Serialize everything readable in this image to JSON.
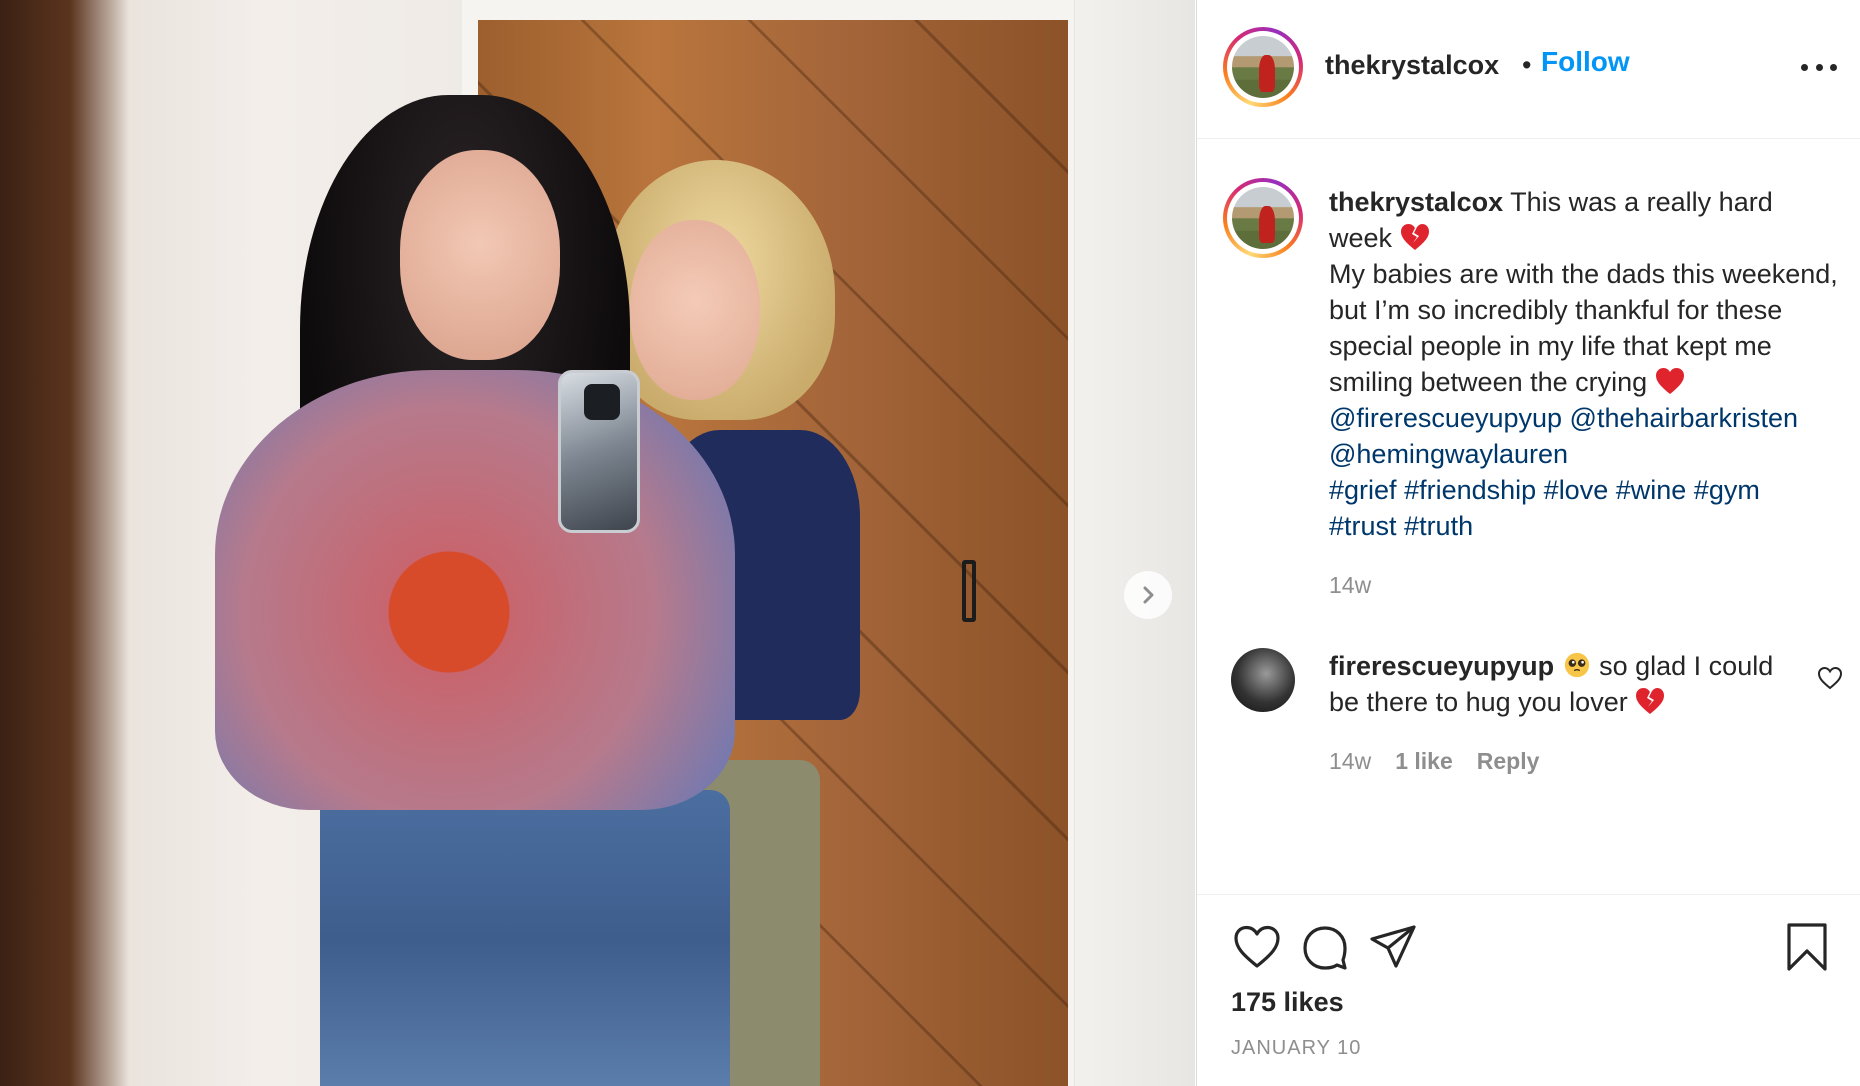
{
  "post": {
    "username": "thekrystalcox",
    "separator": "•",
    "follow_label": "Follow",
    "more_icon": "more-horizontal-icon"
  },
  "caption": {
    "username": "thekrystalcox",
    "line1": " This was a really hard week ",
    "line2": "My babies are with the dads this weekend, but I’m so incredibly thankful for these special people in my life that kept me smiling between the crying ",
    "mentions": [
      "@firerescueyupyup",
      "@thehairbarkristen",
      "@hemingwaylauren"
    ],
    "hashtags": [
      "#grief",
      "#friendship",
      "#love",
      "#wine",
      "#gym",
      "#trust",
      "#truth"
    ],
    "time": "14w",
    "emoji_broken_heart": "broken-heart-emoji",
    "emoji_red_heart": "red-heart-emoji"
  },
  "comment": {
    "username": "firerescueyupyup",
    "text_before": " so glad I could be there to hug you lover ",
    "emoji_pleading": "pleading-face-emoji",
    "emoji_broken_heart": "broken-heart-emoji",
    "time": "14w",
    "likes": "1 like",
    "reply_label": "Reply"
  },
  "actions": {
    "likes": "175 likes",
    "date": "JANUARY 10",
    "icons": [
      "heart-icon",
      "comment-icon",
      "share-icon",
      "bookmark-icon"
    ]
  },
  "carousel": {
    "next_icon": "chevron-right-icon"
  },
  "colors": {
    "link": "#0095f6",
    "tag": "#00376b",
    "muted": "#8e8e8e",
    "text": "#262626",
    "heart_red": "#e0242e"
  }
}
